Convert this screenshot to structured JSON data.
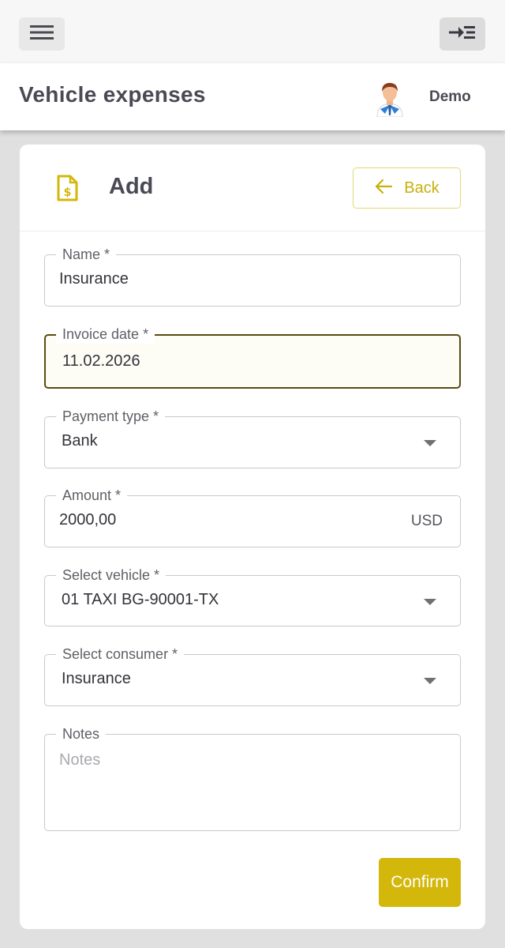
{
  "topbar": {
    "menu_icon": "hamburger-menu-icon",
    "collapse_icon": "arrow-right-to-lines-icon"
  },
  "header": {
    "title": "Vehicle expenses",
    "user_name": "Demo",
    "avatar_icon": "user-avatar"
  },
  "form": {
    "title": "Add",
    "title_icon": "invoice-dollar-icon",
    "back_label": "Back",
    "back_icon": "arrow-left-icon",
    "confirm_label": "Confirm",
    "fields": {
      "name": {
        "label": "Name *",
        "value": "Insurance"
      },
      "invoice_date": {
        "label": "Invoice date *",
        "value": "11.02.2026"
      },
      "payment_type": {
        "label": "Payment type *",
        "value": "Bank"
      },
      "amount": {
        "label": "Amount *",
        "value": "2000,00",
        "suffix": "USD"
      },
      "vehicle": {
        "label": "Select vehicle *",
        "value": "01 TAXI BG-90001-TX"
      },
      "consumer": {
        "label": "Select consumer *",
        "value": "Insurance"
      },
      "notes": {
        "label": "Notes",
        "placeholder": "Notes"
      }
    }
  },
  "colors": {
    "accent": "#d3b70a",
    "accent_text": "#c8b00a",
    "focus_border": "#5a4a12",
    "background": "#e0e0e0"
  }
}
